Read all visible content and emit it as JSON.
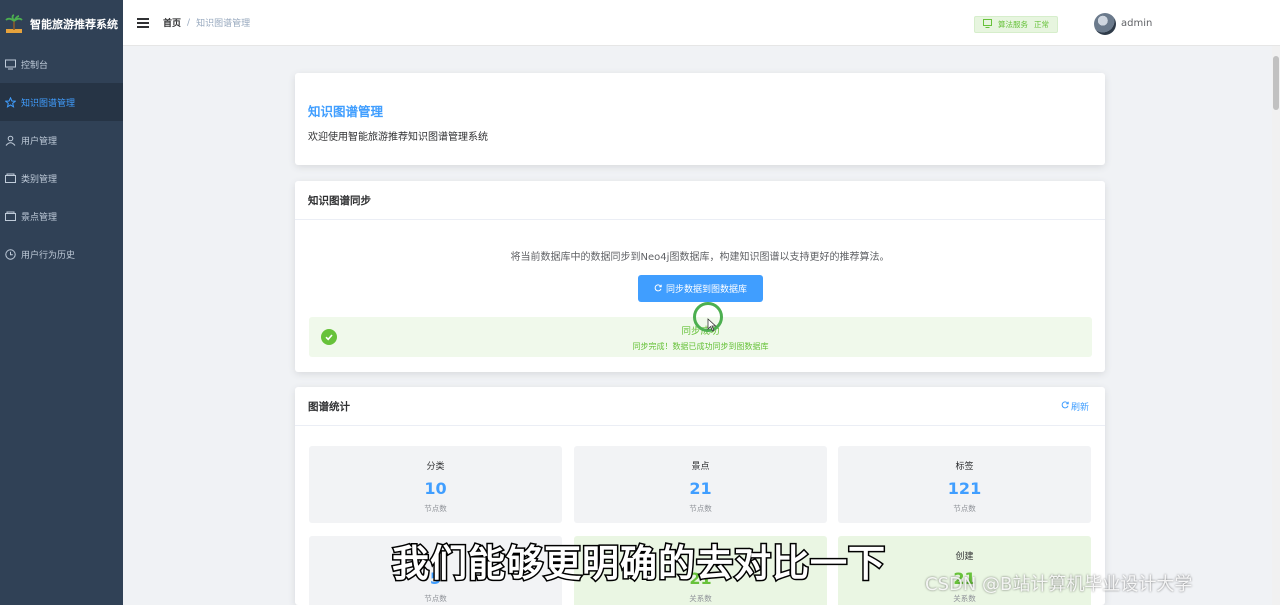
{
  "app": {
    "title": "智能旅游推荐系统"
  },
  "sidebar": {
    "items": [
      {
        "label": "控制台",
        "icon": "monitor-icon"
      },
      {
        "label": "知识图谱管理",
        "icon": "star-icon",
        "active": true
      },
      {
        "label": "用户管理",
        "icon": "user-icon"
      },
      {
        "label": "类别管理",
        "icon": "folder-icon"
      },
      {
        "label": "景点管理",
        "icon": "folder-icon"
      },
      {
        "label": "用户行为历史",
        "icon": "clock-icon"
      }
    ]
  },
  "header": {
    "breadcrumb": {
      "home": "首页",
      "separator": "/",
      "current": "知识图谱管理"
    },
    "algo_service": {
      "label": "算法服务",
      "status": "正常"
    },
    "username": "admin"
  },
  "intro": {
    "title": "知识图谱管理",
    "subtitle": "欢迎使用智能旅游推荐知识图谱管理系统"
  },
  "sync": {
    "title": "知识图谱同步",
    "description": "将当前数据库中的数据同步到Neo4j图数据库，构建知识图谱以支持更好的推荐算法。",
    "button_label": "同步数据到图数据库",
    "alert_title": "同步成功",
    "alert_desc": "同步完成！数据已成功同步到图数据库"
  },
  "stats": {
    "title": "图谱统计",
    "refresh_label": "刷新",
    "cards": [
      {
        "label": "分类",
        "value": "10",
        "unit": "节点数"
      },
      {
        "label": "景点",
        "value": "21",
        "unit": "节点数"
      },
      {
        "label": "标签",
        "value": "121",
        "unit": "节点数"
      },
      {
        "label": "",
        "value": "5",
        "unit": "节点数"
      },
      {
        "label": "",
        "value": "21",
        "unit": "关系数"
      },
      {
        "label": "创建",
        "value": "21",
        "unit": "关系数"
      }
    ]
  },
  "overlay": {
    "subtitle": "我们能够更明确的去对比一下",
    "watermark": "CSDN @B站计算机毕业设计大学"
  },
  "colors": {
    "sidebar_bg": "#304156",
    "accent": "#409eff",
    "success": "#67c23a"
  }
}
